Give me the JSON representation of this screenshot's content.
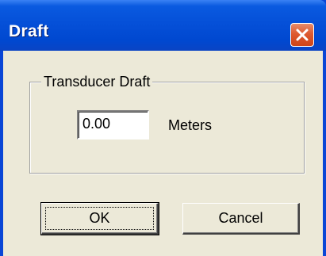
{
  "window": {
    "title": "Draft"
  },
  "group": {
    "label": "Transducer Draft"
  },
  "draft_field": {
    "value": "0.00"
  },
  "unit": {
    "label": "Meters"
  },
  "buttons": {
    "ok_label": "OK",
    "cancel_label": "Cancel"
  },
  "icons": {
    "close": "close-icon"
  },
  "colors": {
    "titlebar": "#0550d8",
    "close_button": "#de5a30",
    "dialog_background": "#ece9d8"
  }
}
